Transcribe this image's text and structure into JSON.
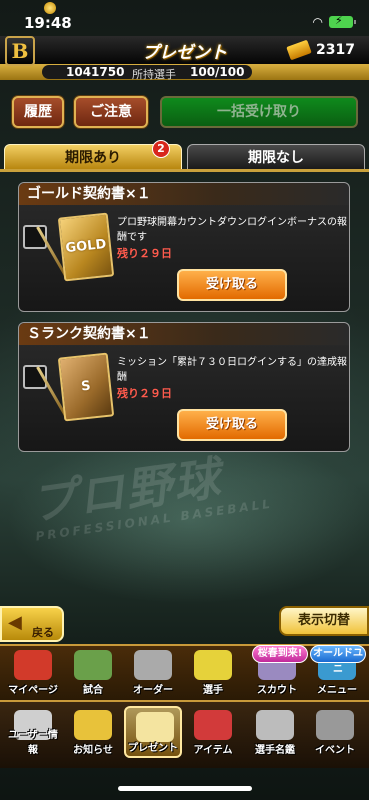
{
  "status": {
    "time": "19:48"
  },
  "header": {
    "logo_letter": "B",
    "title": "プレゼント",
    "coins": "2317"
  },
  "info": {
    "money": "1041750",
    "owned_label": "所持選手",
    "owned_value": "100/100"
  },
  "actions": {
    "history": "履歴",
    "caution": "ご注意",
    "receive_all": "一括受け取り"
  },
  "tabs": [
    {
      "label": "期限あり",
      "badge": "2",
      "active": true
    },
    {
      "label": "期限なし",
      "active": false
    }
  ],
  "presents": [
    {
      "title": "ゴールド契約書×１",
      "image_label": "GOLD",
      "description": "プロ野球開幕カウントダウンログインボーナスの報酬です",
      "remaining": "残り２９日",
      "button": "受け取る"
    },
    {
      "title": "Ｓランク契約書×１",
      "image_label": "S",
      "description": "ミッション「累計７３０日ログインする」の達成報酬",
      "remaining": "残り２９日",
      "button": "受け取る"
    }
  ],
  "background": {
    "logo_big": "プロ野球",
    "logo_small": "PROFESSIONAL BASEBALL"
  },
  "bottom": {
    "back": "戻る",
    "toggle": "表示切替",
    "nav_top": [
      {
        "label": "マイページ",
        "color": "#d23a2a"
      },
      {
        "label": "試合",
        "color": "#6aa04a"
      },
      {
        "label": "オーダー",
        "color": "#aaaaaa"
      },
      {
        "label": "選手",
        "color": "#e6d23a"
      },
      {
        "label": "スカウト",
        "color": "#9a8ac0"
      },
      {
        "label": "メニュー",
        "color": "#3a9ad0"
      }
    ],
    "tag_spring": "桜春到来!",
    "tag_allstar": "オールドユニ",
    "nav_bottom": [
      {
        "label": "ユーザー情報",
        "color": "#cfcfcf"
      },
      {
        "label": "お知らせ",
        "color": "#e8c23a"
      },
      {
        "label": "プレゼント",
        "color": "#f4e4a0",
        "selected": true
      },
      {
        "label": "アイテム",
        "color": "#d23a3a"
      },
      {
        "label": "選手名鑑",
        "color": "#bcbcbc"
      },
      {
        "label": "イベント",
        "color": "#999999"
      }
    ]
  }
}
